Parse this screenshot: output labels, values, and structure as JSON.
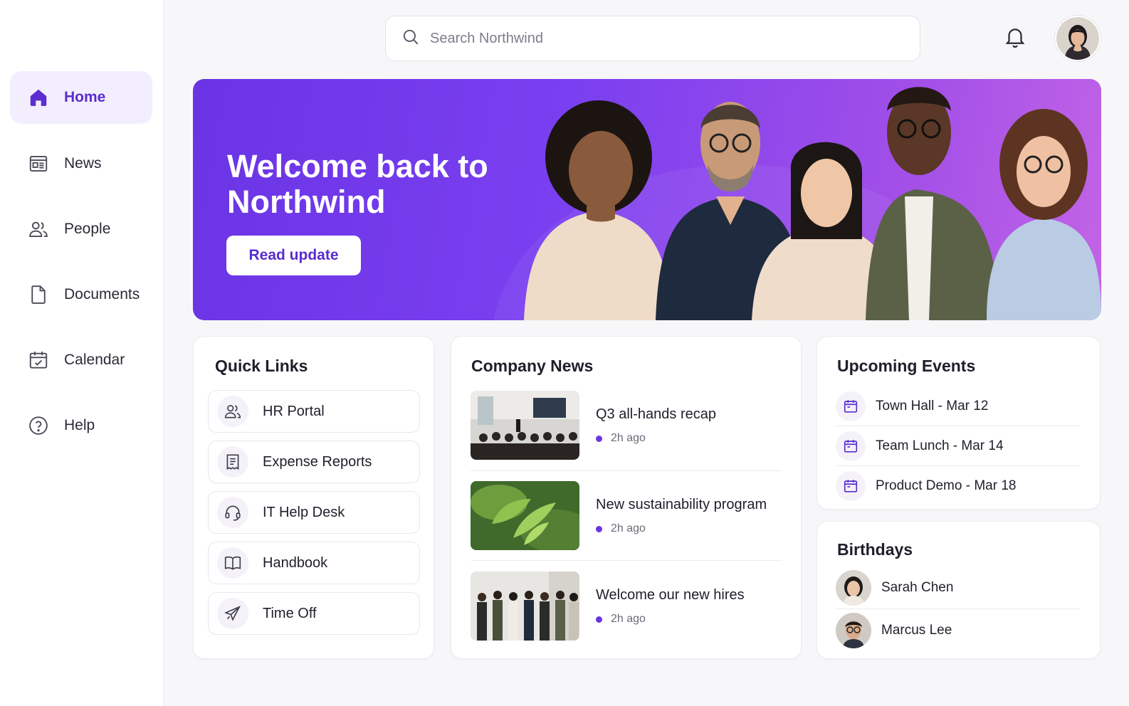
{
  "search": {
    "placeholder": "Search Northwind"
  },
  "topbar": {
    "bell_icon": "bell-icon",
    "user_avatar": "user-avatar"
  },
  "sidebar": {
    "items": [
      {
        "label": "Home",
        "icon": "home-icon",
        "active": true
      },
      {
        "label": "News",
        "icon": "newspaper-icon"
      },
      {
        "label": "People",
        "icon": "people-icon"
      },
      {
        "label": "Documents",
        "icon": "document-icon"
      },
      {
        "label": "Calendar",
        "icon": "calendar-icon"
      },
      {
        "label": "Help",
        "icon": "help-icon"
      }
    ]
  },
  "hero": {
    "title": "Welcome back to Northwind",
    "button": "Read update"
  },
  "quick_links": {
    "title": "Quick Links",
    "items": [
      {
        "label": "HR Portal",
        "icon": "people-icon"
      },
      {
        "label": "Expense Reports",
        "icon": "receipt-icon"
      },
      {
        "label": "IT Help Desk",
        "icon": "headset-icon"
      },
      {
        "label": "Handbook",
        "icon": "book-icon"
      },
      {
        "label": "Time Off",
        "icon": "plane-icon"
      }
    ]
  },
  "company_news": {
    "title": "Company News",
    "items": [
      {
        "title": "Q3 all-hands recap",
        "time": "2h ago"
      },
      {
        "title": "New sustainability program",
        "time": "2h ago"
      },
      {
        "title": "Welcome our new hires",
        "time": "2h ago"
      }
    ]
  },
  "events": {
    "title": "Upcoming Events",
    "items": [
      {
        "label": "Town Hall - Mar 12"
      },
      {
        "label": "Team Lunch - Mar 14"
      },
      {
        "label": "Product Demo - Mar 18"
      }
    ]
  },
  "birthdays": {
    "title": "Birthdays",
    "items": [
      {
        "name": "Sarah Chen"
      },
      {
        "name": "Marcus Lee"
      }
    ]
  },
  "colors": {
    "accent": "#6a34e4",
    "accent_dark": "#5b2ccf",
    "active_bg": "#f3eefe"
  }
}
